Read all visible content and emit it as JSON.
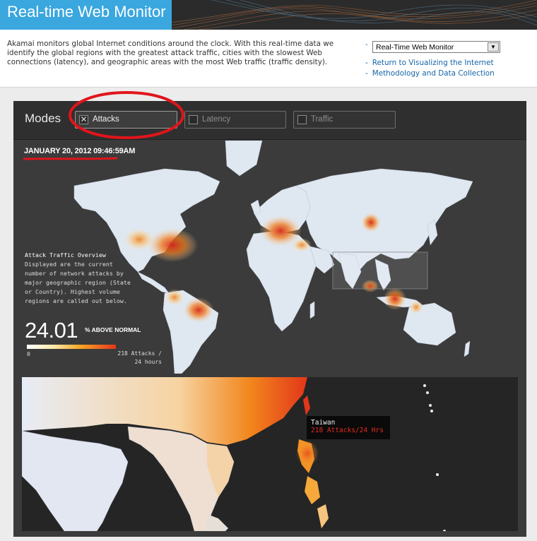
{
  "app_title": "Real-time Web Monitor",
  "intro": {
    "description": "Akamai monitors global Internet conditions around the clock. With this real-time data we identify the global regions with the greatest attack traffic, cities with the slowest Web connections (latency), and geographic areas with the most Web traffic (traffic density)."
  },
  "view_select": {
    "selected": "Real-Time Web Monitor"
  },
  "links": [
    {
      "label": "Return to Visualizing the Internet"
    },
    {
      "label": "Methodology and Data Collection"
    }
  ],
  "modes": {
    "label": "Modes",
    "items": [
      {
        "label": "Attacks",
        "checked": true
      },
      {
        "label": "Latency",
        "checked": false
      },
      {
        "label": "Traffic",
        "checked": false
      }
    ]
  },
  "timestamp": "JANUARY 20, 2012 09:46:59AM",
  "overview": {
    "title": "Attack Traffic Overview",
    "lines": [
      "Displayed are the current",
      "number of network attacks by",
      "major geographic region (State",
      "or Country). Highest volume",
      "regions are called out below."
    ]
  },
  "stat": {
    "value": "24.01",
    "label": "% ABOVE NORMAL"
  },
  "scale": {
    "min": "0",
    "max_line1": "218 Attacks /",
    "max_line2": "24 hours"
  },
  "tooltip": {
    "region": "Taiwan",
    "value": "218 Attacks/24 Hrs"
  },
  "colors": {
    "brand_blue": "#3aa7df",
    "link": "#1565a8",
    "heat_high": "#e3361b",
    "annotation_red": "#e0151b"
  }
}
